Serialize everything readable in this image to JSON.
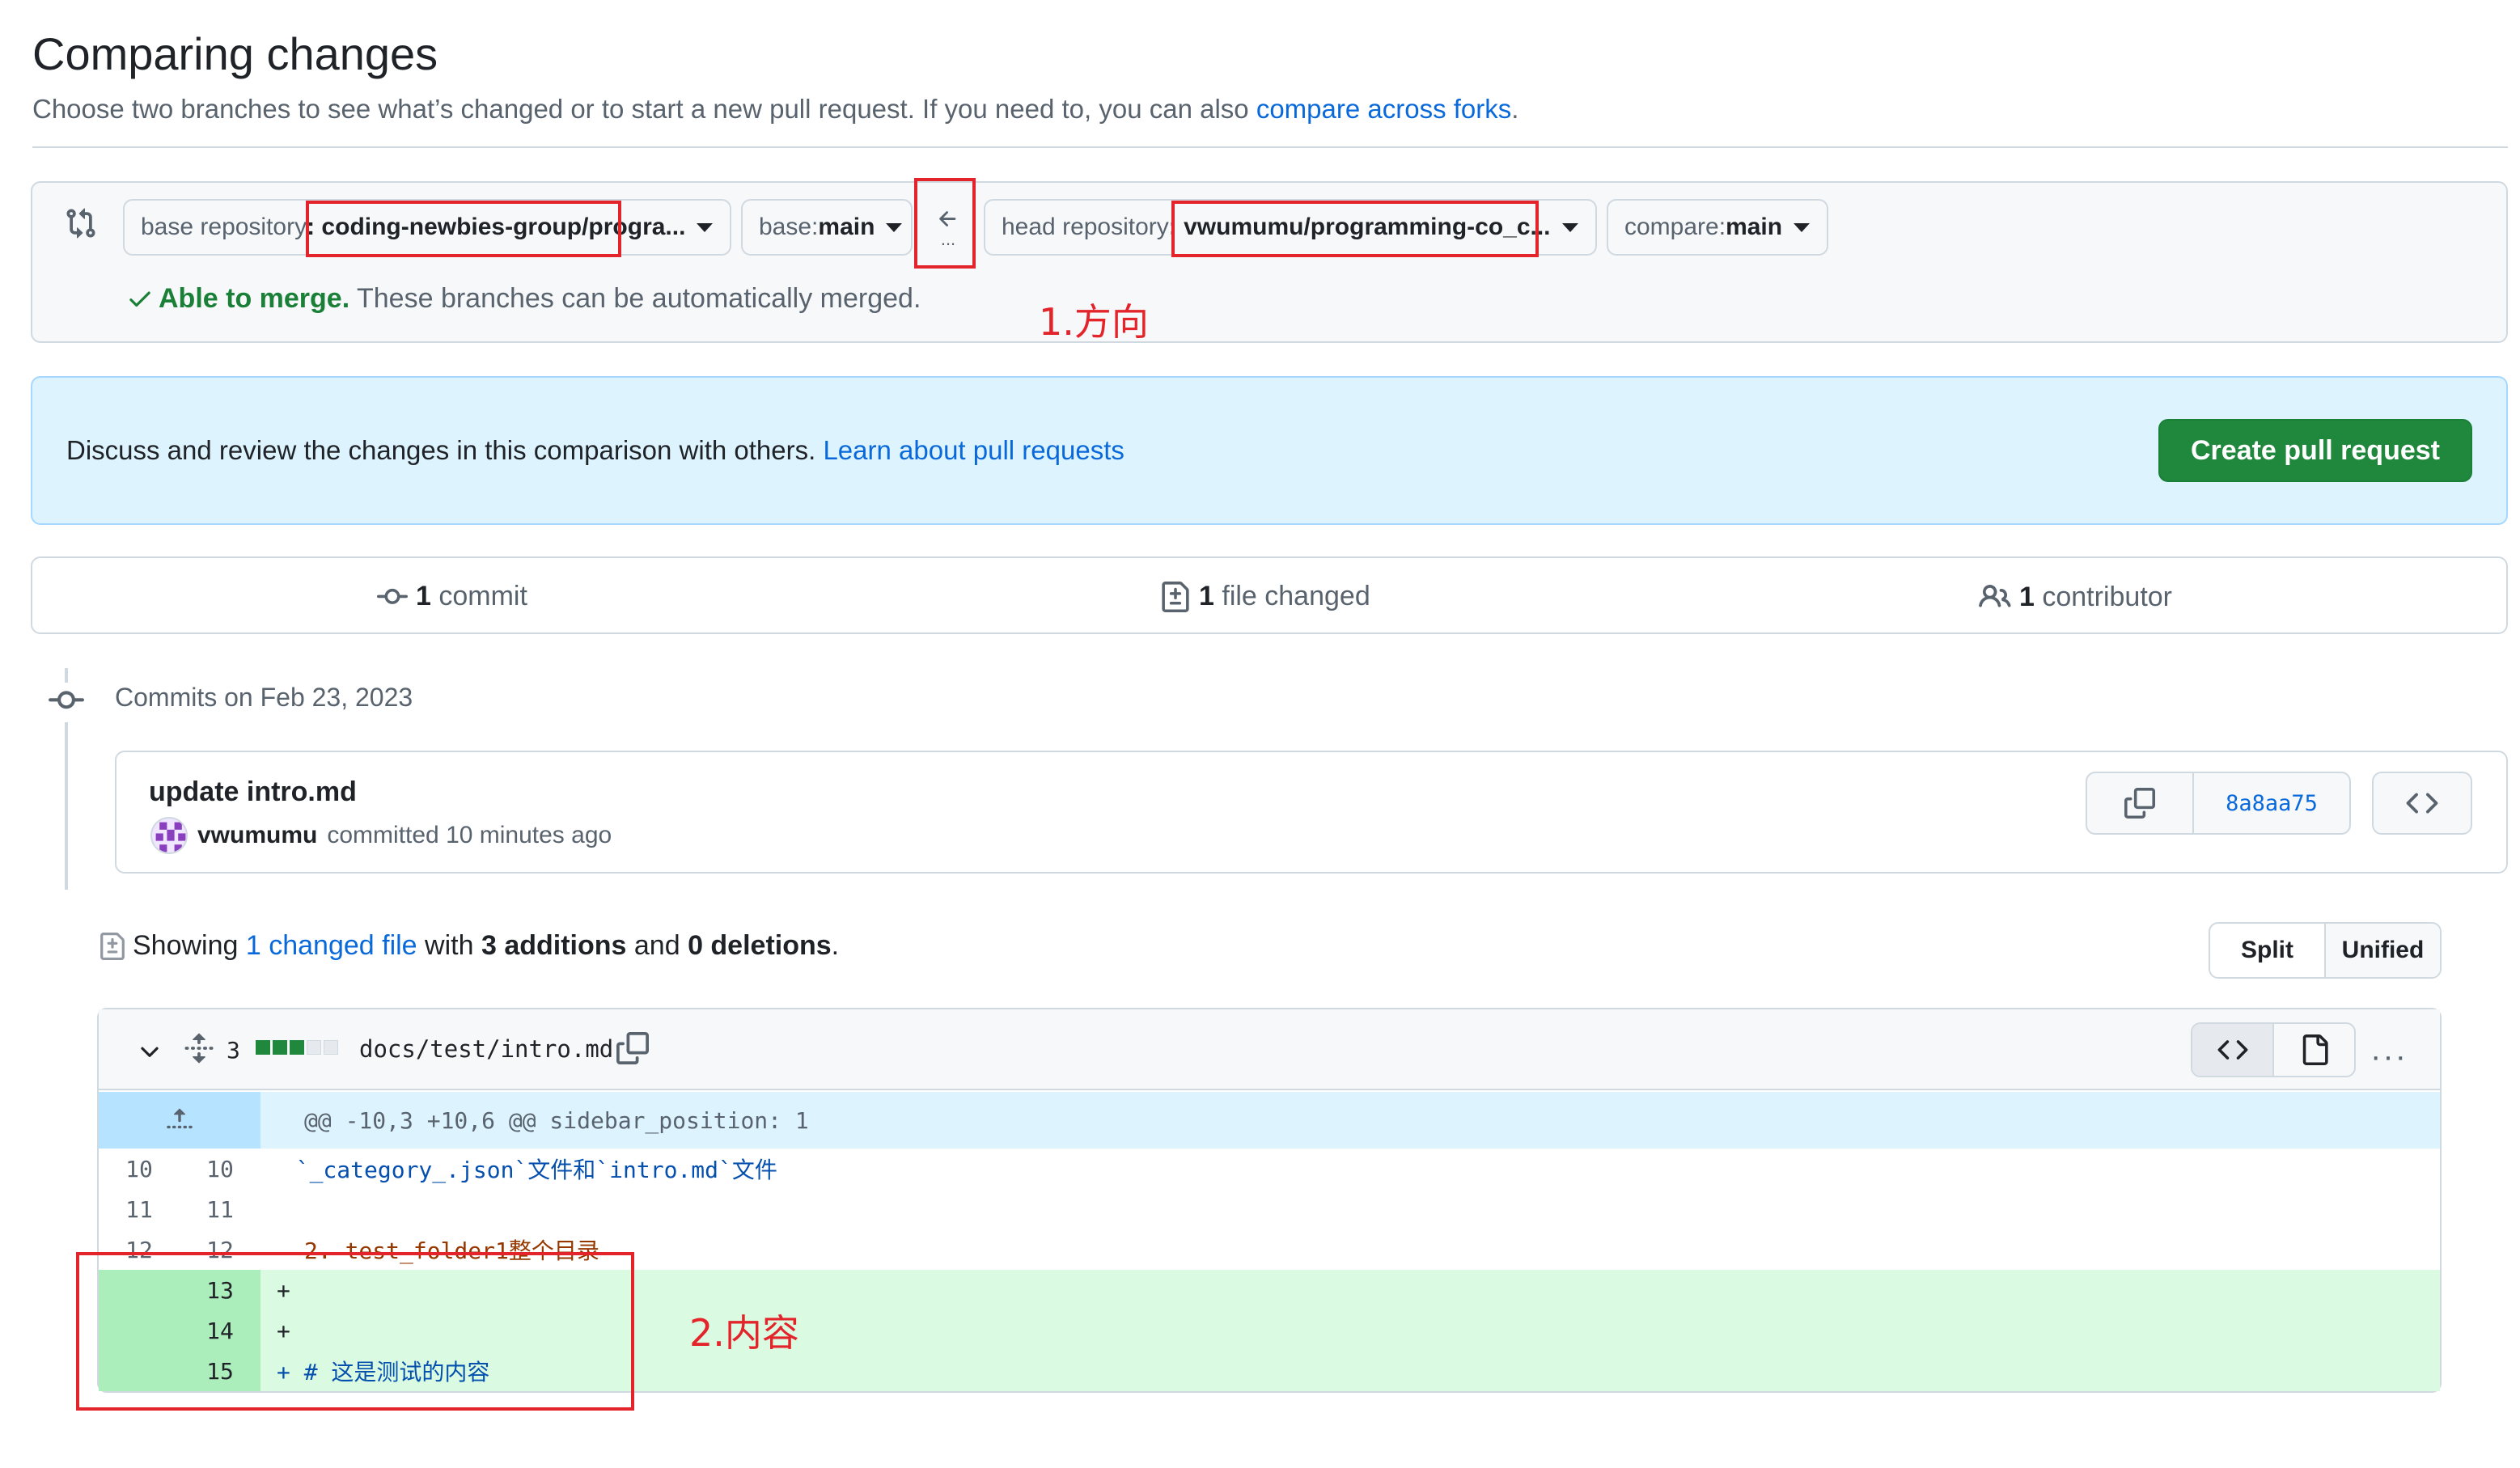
{
  "header": {
    "title": "Comparing changes",
    "subtitle_prefix": "Choose two branches to see what’s changed or to start a new pull request. If you need to, you can also ",
    "subtitle_link": "compare across forks",
    "subtitle_suffix": "."
  },
  "range_editor": {
    "base_repo_label": "base repository",
    "base_repo_value": ": coding-newbies-group/progra...",
    "base_branch_label": "base: ",
    "base_branch_value": "main",
    "swap_dots": "...",
    "head_repo_label": "head repository",
    "head_repo_value": ": vwumumu/programming-co_c...",
    "compare_branch_label": "compare: ",
    "compare_branch_value": "main",
    "merge_status": "Able to merge.",
    "merge_message": " These branches can be automatically merged."
  },
  "annotations": {
    "direction": "1.方向",
    "content": "2.内容",
    "color": "#e3242b"
  },
  "discuss": {
    "text": "Discuss and review the changes in this comparison with others. ",
    "link": "Learn about pull requests",
    "create_button": "Create pull request"
  },
  "stats": {
    "commits_count": "1",
    "commits_label": " commit",
    "files_count": "1",
    "files_label": " file changed",
    "contributors_count": "1",
    "contributors_label": " contributor"
  },
  "commits": {
    "date_heading": "Commits on Feb 23, 2023",
    "title": "update intro.md",
    "author": "vwumumu",
    "meta": "committed 10 minutes ago",
    "sha": "8a8aa75"
  },
  "summary": {
    "prefix": "Showing ",
    "changed_link": "1 changed file",
    "with": " with ",
    "additions": "3 additions",
    "and": " and ",
    "deletions": "0 deletions",
    "suffix": ".",
    "split_label": "Split",
    "unified_label": "Unified"
  },
  "diff": {
    "changes_count": "3",
    "file_path": "docs/test/intro.md",
    "hunk_header": "@@ -10,3 +10,6 @@ sidebar_position: 1",
    "lines": [
      {
        "old": "10",
        "new": "10",
        "code": "  `_category_.json`文件和`intro.md`文件",
        "type": "context"
      },
      {
        "old": "11",
        "new": "11",
        "code": "",
        "type": "context"
      },
      {
        "old": "12",
        "new": "12",
        "code": "2. test_folder1整个目录",
        "type": "context"
      },
      {
        "old": "",
        "new": "13",
        "code": "+",
        "type": "add"
      },
      {
        "old": "",
        "new": "14",
        "code": "+",
        "type": "add"
      },
      {
        "old": "",
        "new": "15",
        "code": "+ # 这是测试的内容",
        "type": "add"
      }
    ]
  }
}
